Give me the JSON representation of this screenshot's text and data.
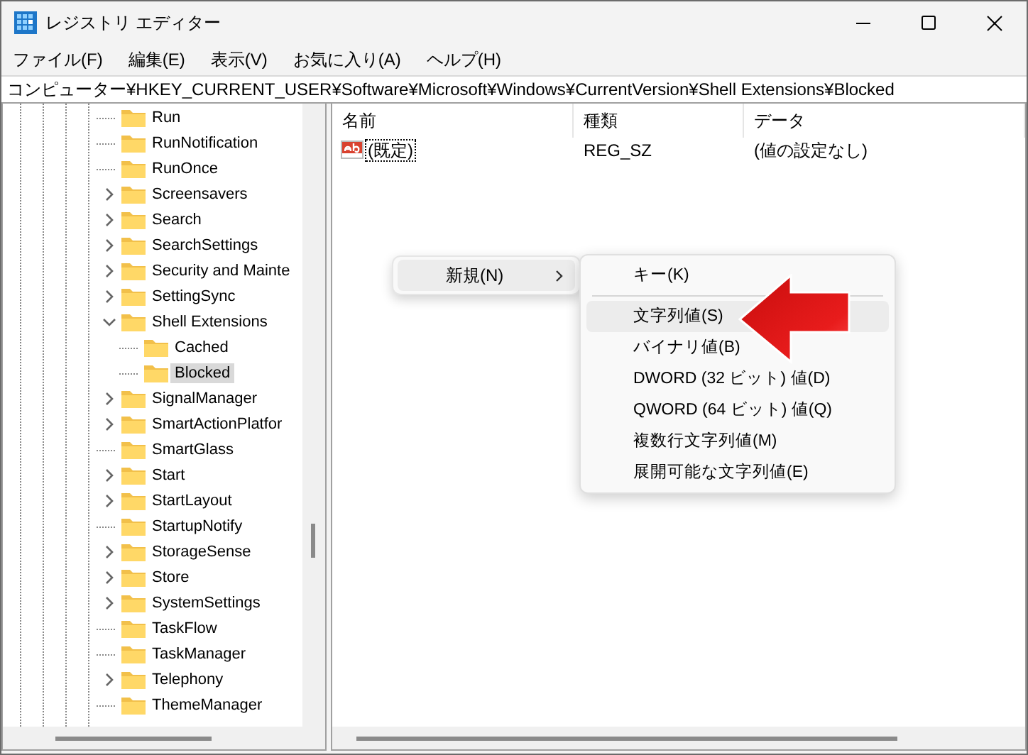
{
  "window": {
    "title": "レジストリ エディター"
  },
  "menu": [
    "ファイル(F)",
    "編集(E)",
    "表示(V)",
    "お気に入り(A)",
    "ヘルプ(H)"
  ],
  "address": "コンピューター¥HKEY_CURRENT_USER¥Software¥Microsoft¥Windows¥CurrentVersion¥Shell Extensions¥Blocked",
  "tree": [
    {
      "label": "Run",
      "selected": false
    },
    {
      "label": "RunNotification",
      "selected": false
    },
    {
      "label": "RunOnce",
      "selected": false
    },
    {
      "label": "Screensavers",
      "expanded": false,
      "selected": false
    },
    {
      "label": "Search",
      "expanded": false,
      "selected": false
    },
    {
      "label": "SearchSettings",
      "expanded": false,
      "selected": false
    },
    {
      "label": "Security and Mainte",
      "expanded": false,
      "selected": false
    },
    {
      "label": "SettingSync",
      "expanded": false,
      "selected": false
    },
    {
      "label": "Shell Extensions",
      "expanded": true,
      "selected": false,
      "children": [
        {
          "label": "Cached",
          "selected": false
        },
        {
          "label": "Blocked",
          "selected": true
        }
      ]
    },
    {
      "label": "SignalManager",
      "expanded": false,
      "selected": false
    },
    {
      "label": "SmartActionPlatfor",
      "expanded": false,
      "selected": false
    },
    {
      "label": "SmartGlass",
      "selected": false
    },
    {
      "label": "Start",
      "expanded": false,
      "selected": false
    },
    {
      "label": "StartLayout",
      "expanded": false,
      "selected": false
    },
    {
      "label": "StartupNotify",
      "selected": false
    },
    {
      "label": "StorageSense",
      "expanded": false,
      "selected": false
    },
    {
      "label": "Store",
      "expanded": false,
      "selected": false
    },
    {
      "label": "SystemSettings",
      "expanded": false,
      "selected": false
    },
    {
      "label": "TaskFlow",
      "selected": false
    },
    {
      "label": "TaskManager",
      "selected": false
    },
    {
      "label": "Telephony",
      "expanded": false,
      "selected": false
    },
    {
      "label": "ThemeManager",
      "selected": false
    }
  ],
  "list": {
    "columns": [
      "名前",
      "種類",
      "データ"
    ],
    "rows": [
      {
        "name": "(既定)",
        "type": "REG_SZ",
        "data": "(値の設定なし)",
        "focused": true
      }
    ]
  },
  "context_menu": {
    "items": [
      {
        "label": "新規(N)",
        "has_submenu": true,
        "selected": true
      }
    ]
  },
  "submenu": {
    "items": [
      {
        "kind": "item",
        "label": "キー(K)",
        "selected": false
      },
      {
        "kind": "separator"
      },
      {
        "kind": "item",
        "label": "文字列値(S)",
        "selected": true
      },
      {
        "kind": "item",
        "label": "バイナリ値(B)",
        "selected": false
      },
      {
        "kind": "item",
        "label": "DWORD (32 ビット) 値(D)",
        "selected": false
      },
      {
        "kind": "item",
        "label": "QWORD (64 ビット) 値(Q)",
        "selected": false
      },
      {
        "kind": "item",
        "label": "複数行文字列値(M)",
        "selected": false
      },
      {
        "kind": "item",
        "label": "展開可能な文字列値(E)",
        "selected": false
      }
    ]
  }
}
